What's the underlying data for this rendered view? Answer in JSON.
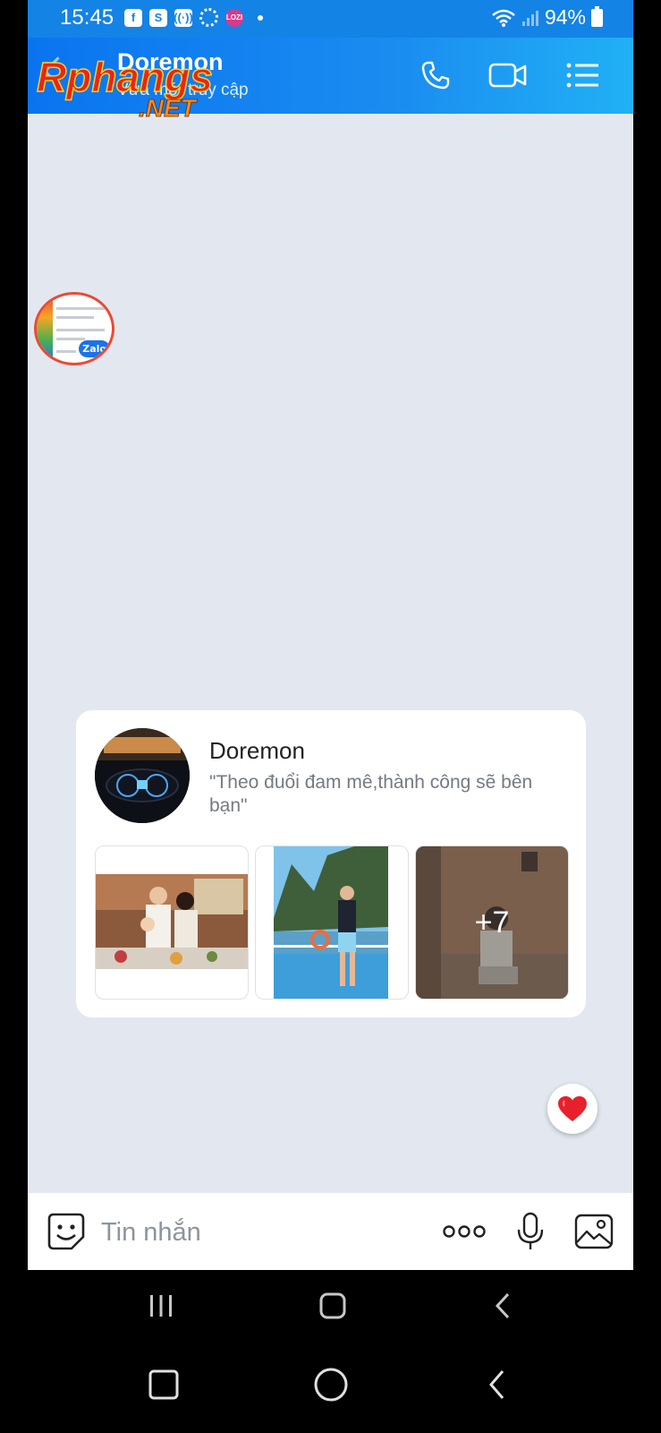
{
  "status_bar": {
    "time": "15:45",
    "battery": "94%",
    "notification_icons": [
      "facebook-icon",
      "s-icon",
      "broadcast-icon",
      "loading-icon",
      "lozi-icon"
    ]
  },
  "header": {
    "contact_name": "Doremon",
    "contact_status": "Vừa mới truy cập",
    "watermark_main": "Rphangs",
    "watermark_sub": ".NET",
    "accent": "#1483e6"
  },
  "shared_link": {
    "badge": "Zalo"
  },
  "profile_card": {
    "name": "Doremon",
    "quote": "\"Theo đuổi đam mê,thành công sẽ bên bạn\"",
    "more_photos": "+7"
  },
  "input_bar": {
    "placeholder": "Tin nhắn"
  }
}
